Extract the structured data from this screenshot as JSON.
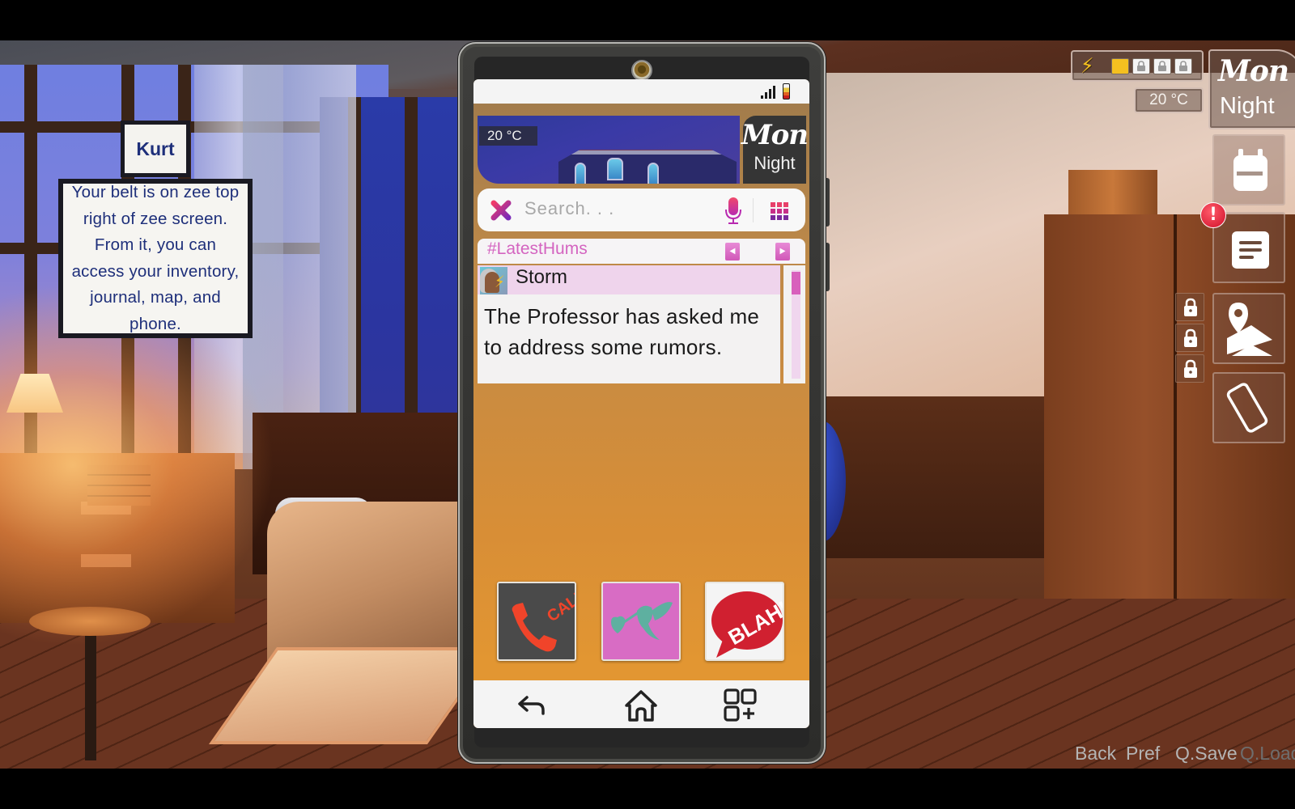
{
  "dialogue": {
    "speaker": "Kurt",
    "text": "Your belt is on zee top right of zee screen. From it, you can access your inventory, journal, map, and phone."
  },
  "phone": {
    "status": {
      "signal_icon": "signal-bars-icon",
      "battery_icon": "battery-icon"
    },
    "banner": {
      "temperature": "20 °C",
      "day": "Mon",
      "time_of_day": "Night"
    },
    "search": {
      "placeholder": "Search. . .",
      "clear_icon": "close-x-icon",
      "mic_icon": "microphone-icon",
      "grid_icon": "apps-grid-icon"
    },
    "feed": {
      "title": "#LatestHums",
      "prev_icon": "arrow-left-icon",
      "next_icon": "arrow-right-icon",
      "posts": [
        {
          "author": "Storm",
          "text": "The Professor has asked me to address some rumors."
        }
      ]
    },
    "apps": [
      {
        "name": "Call",
        "label": "CALL",
        "color": "#4a4a4a",
        "accent": "#f0442a"
      },
      {
        "name": "Hummingbird",
        "label": "",
        "color": "#d86cc4",
        "accent": "#5eb0a0"
      },
      {
        "name": "Blah",
        "label": "BLAH!",
        "color": "#f4f4f4",
        "accent": "#d02030"
      }
    ],
    "nav": {
      "back_icon": "back-arrow-icon",
      "home_icon": "home-icon",
      "apps_icon": "add-widget-icon"
    }
  },
  "hud": {
    "energy": {
      "filled": 1,
      "total": 4,
      "icon": "lightning-icon",
      "accent": "#f4c020"
    },
    "temperature": "20 °C",
    "day": "Mon",
    "time_of_day": "Night",
    "belt": [
      {
        "name": "inventory",
        "icon": "backpack-icon"
      },
      {
        "name": "journal",
        "icon": "journal-icon",
        "alert": "!"
      },
      {
        "name": "map",
        "icon": "map-pin-icon"
      },
      {
        "name": "phone",
        "icon": "phone-icon"
      }
    ],
    "locked_slots": 3
  },
  "quick_menu": [
    {
      "label": "Back",
      "enabled": true
    },
    {
      "label": "Pref",
      "enabled": true
    },
    {
      "label": "Q.Save",
      "enabled": true
    },
    {
      "label": "Q.Load",
      "enabled": false
    }
  ]
}
